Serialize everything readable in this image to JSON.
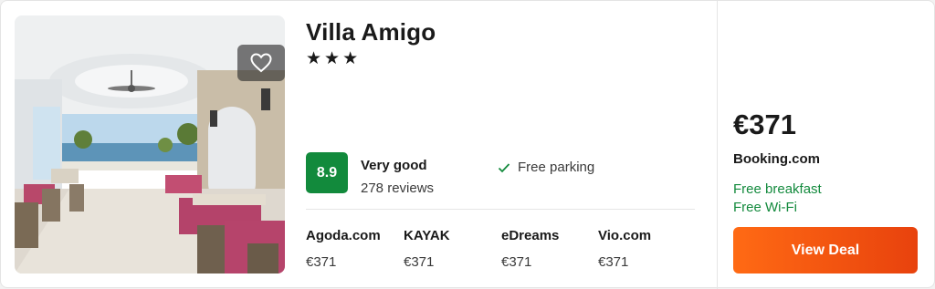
{
  "hotel": {
    "name": "Villa Amigo",
    "stars": "★★★",
    "star_count": 3
  },
  "rating": {
    "score": "8.9",
    "label": "Very good",
    "reviews": "278 reviews",
    "badge_color": "#128a3c"
  },
  "amenities": [
    {
      "label": "Free parking",
      "icon": "check-icon"
    }
  ],
  "providers": [
    {
      "name": "Agoda.com",
      "price": "€371"
    },
    {
      "name": "KAYAK",
      "price": "€371"
    },
    {
      "name": "eDreams",
      "price": "€371"
    },
    {
      "name": "Vio.com",
      "price": "€371"
    }
  ],
  "deal": {
    "price": "€371",
    "site": "Booking.com",
    "perks": [
      "Free breakfast",
      "Free Wi-Fi"
    ],
    "button_label": "View Deal",
    "button_color": "#ff6a14",
    "perk_color": "#138a3d"
  },
  "photo": {
    "alt": "",
    "favorite_icon": "heart-icon"
  }
}
